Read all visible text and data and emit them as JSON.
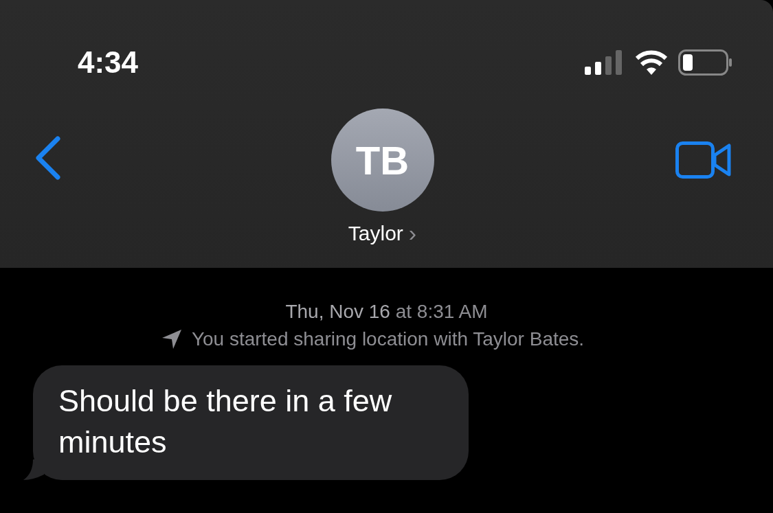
{
  "status_bar": {
    "time": "4:34"
  },
  "header": {
    "avatar_initials": "TB",
    "contact_name": "Taylor",
    "chevron": "›"
  },
  "conversation": {
    "timestamp": "**Thu, Nov 16** at 8:31 AM",
    "notice": "You started sharing location with Taylor Bates.",
    "messages": [
      {
        "kind": "incoming",
        "text": "Should be there in a few minutes"
      }
    ]
  }
}
